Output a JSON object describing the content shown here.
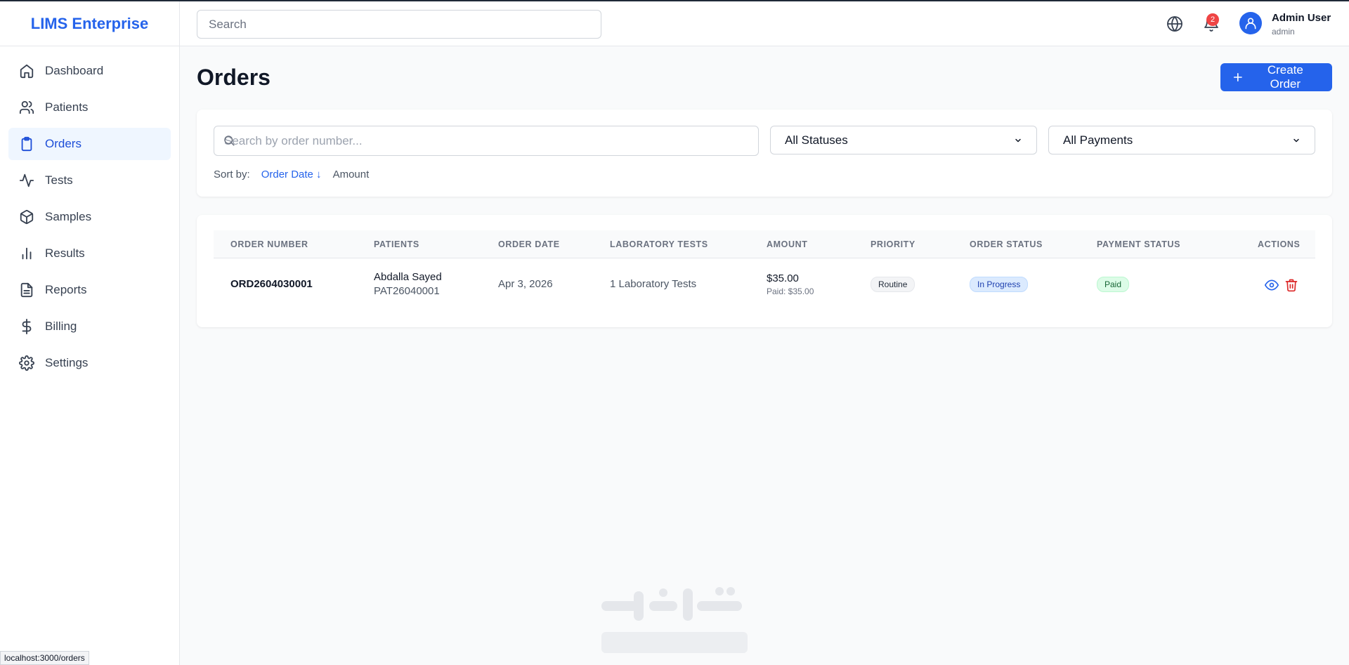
{
  "brand": "LIMS Enterprise",
  "header": {
    "search_placeholder": "Search",
    "notifications_count": "2",
    "user_name": "Admin User",
    "user_role": "admin"
  },
  "sidebar": {
    "items": [
      {
        "label": "Dashboard",
        "icon": "home-icon"
      },
      {
        "label": "Patients",
        "icon": "users-icon"
      },
      {
        "label": "Orders",
        "icon": "clipboard-icon",
        "active": true
      },
      {
        "label": "Tests",
        "icon": "activity-icon"
      },
      {
        "label": "Samples",
        "icon": "package-icon"
      },
      {
        "label": "Results",
        "icon": "bar-chart-icon"
      },
      {
        "label": "Reports",
        "icon": "file-text-icon"
      },
      {
        "label": "Billing",
        "icon": "dollar-icon"
      },
      {
        "label": "Settings",
        "icon": "gear-icon"
      }
    ]
  },
  "page": {
    "title": "Orders",
    "create_button": "Create Order"
  },
  "filters": {
    "search_placeholder": "Search by order number...",
    "status_selected": "All Statuses",
    "payment_selected": "All Payments",
    "sort_label": "Sort by:",
    "sort_options": [
      "Order Date ↓",
      "Amount"
    ]
  },
  "table": {
    "headers": [
      "ORDER NUMBER",
      "PATIENTS",
      "ORDER DATE",
      "LABORATORY TESTS",
      "AMOUNT",
      "PRIORITY",
      "ORDER STATUS",
      "PAYMENT STATUS",
      "ACTIONS"
    ],
    "rows": [
      {
        "order_number": "ORD2604030001",
        "patient_name": "Abdalla Sayed",
        "patient_id": "PAT26040001",
        "order_date": "Apr 3, 2026",
        "tests": "1 Laboratory Tests",
        "amount": "$35.00",
        "paid": "Paid: $35.00",
        "priority": "Routine",
        "order_status": "In Progress",
        "payment_status": "Paid"
      }
    ]
  },
  "status_bar_url": "localhost:3000/orders",
  "colors": {
    "primary": "#2563eb",
    "danger": "#dc2626",
    "badge": "#ef4444"
  }
}
